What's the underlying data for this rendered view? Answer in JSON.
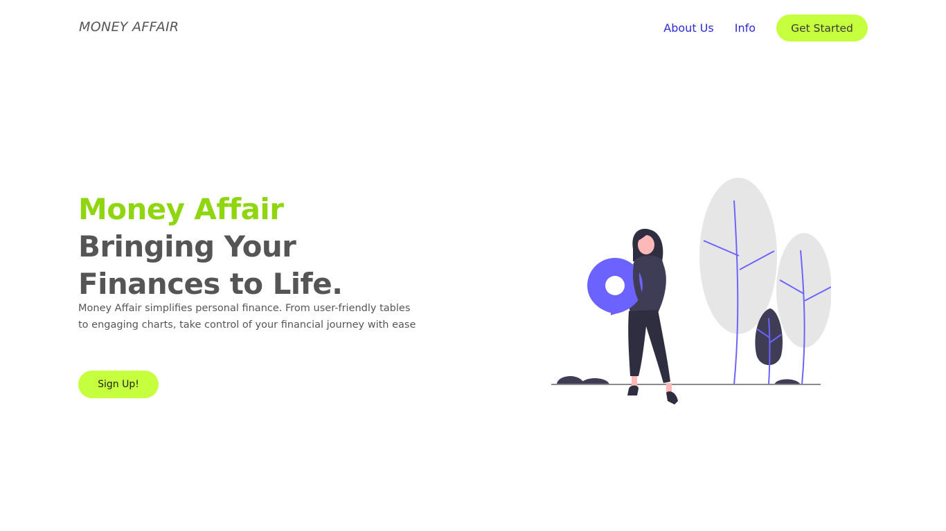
{
  "header": {
    "logo": "MONEY AFFAIR",
    "nav": {
      "about": "About Us",
      "info": "Info",
      "get_started": "Get Started"
    }
  },
  "hero": {
    "brand": "Money Affair",
    "title_line1": "Bringing Your",
    "title_line2": "Finances to Life.",
    "description": "Money Affair simplifies personal finance. From user-friendly tables to engaging charts, take control of your financial journey with ease",
    "signup": "Sign Up!"
  },
  "colors": {
    "accent_green": "#c5ff3d",
    "brand_green": "#8fd611",
    "link_blue": "#2b2bd8",
    "illustration_purple": "#6c63ff"
  },
  "icons": {
    "illustration": "woman-holding-location-pin-with-trees"
  }
}
